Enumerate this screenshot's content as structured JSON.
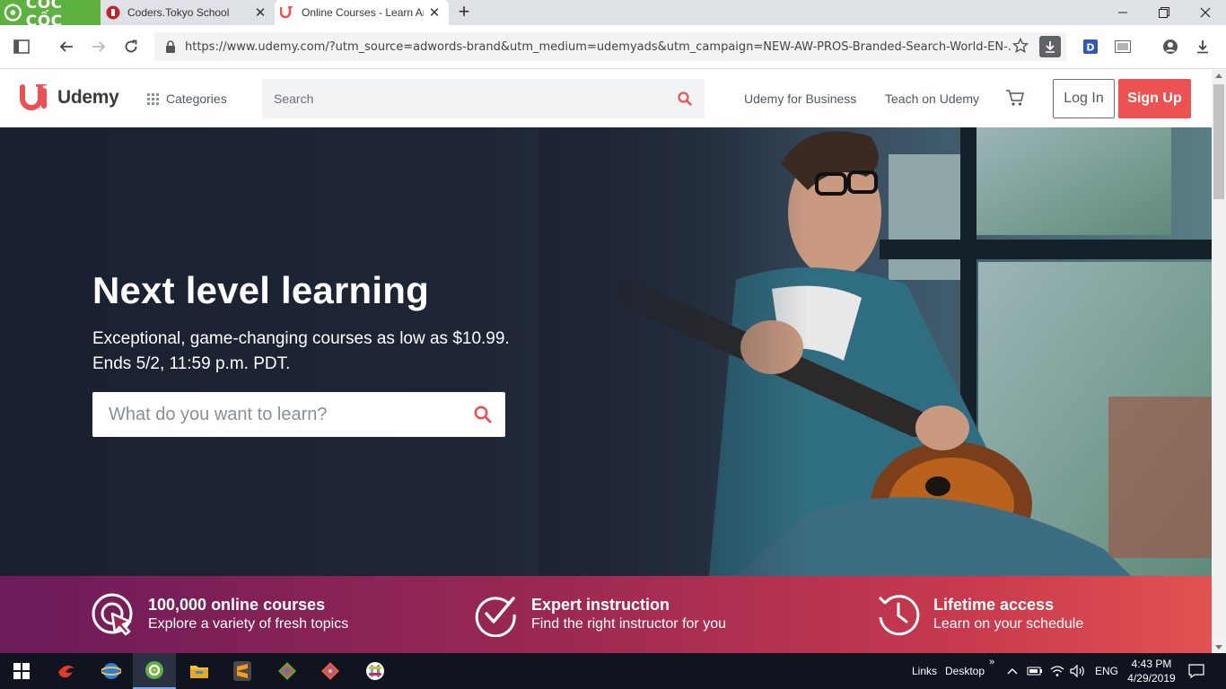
{
  "browser": {
    "brand": "CỐC CỐC",
    "tabs": [
      {
        "title": "Coders.Tokyo School",
        "active": false
      },
      {
        "title": "Online Courses - Learn Anything",
        "active": true
      }
    ],
    "url": "https://www.udemy.com/?utm_source=adwords-brand&utm_medium=udemyads&utm_campaign=NEW-AW-PROS-Branded-Search-World-EN-..."
  },
  "header": {
    "logo": "Udemy",
    "categories": "Categories",
    "search_placeholder": "Search",
    "business": "Udemy for Business",
    "teach": "Teach on Udemy",
    "login": "Log In",
    "signup": "Sign Up"
  },
  "hero": {
    "title": "Next level learning",
    "subtitle_line1": "Exceptional, game-changing courses as low as $10.99.",
    "subtitle_line2": "Ends 5/2, 11:59 p.m. PDT.",
    "search_placeholder": "What do you want to learn?"
  },
  "features": [
    {
      "title": "100,000 online courses",
      "desc": "Explore a variety of fresh topics",
      "icon": "cursor-target-icon"
    },
    {
      "title": "Expert instruction",
      "desc": "Find the right instructor for you",
      "icon": "check-badge-icon"
    },
    {
      "title": "Lifetime access",
      "desc": "Learn on your schedule",
      "icon": "history-clock-icon"
    }
  ],
  "taskbar": {
    "links": "Links",
    "desktop": "Desktop",
    "language": "ENG",
    "time": "4:43 PM",
    "date": "4/29/2019"
  },
  "colors": {
    "accent": "#ec5252",
    "brand_green": "#5db13e"
  }
}
